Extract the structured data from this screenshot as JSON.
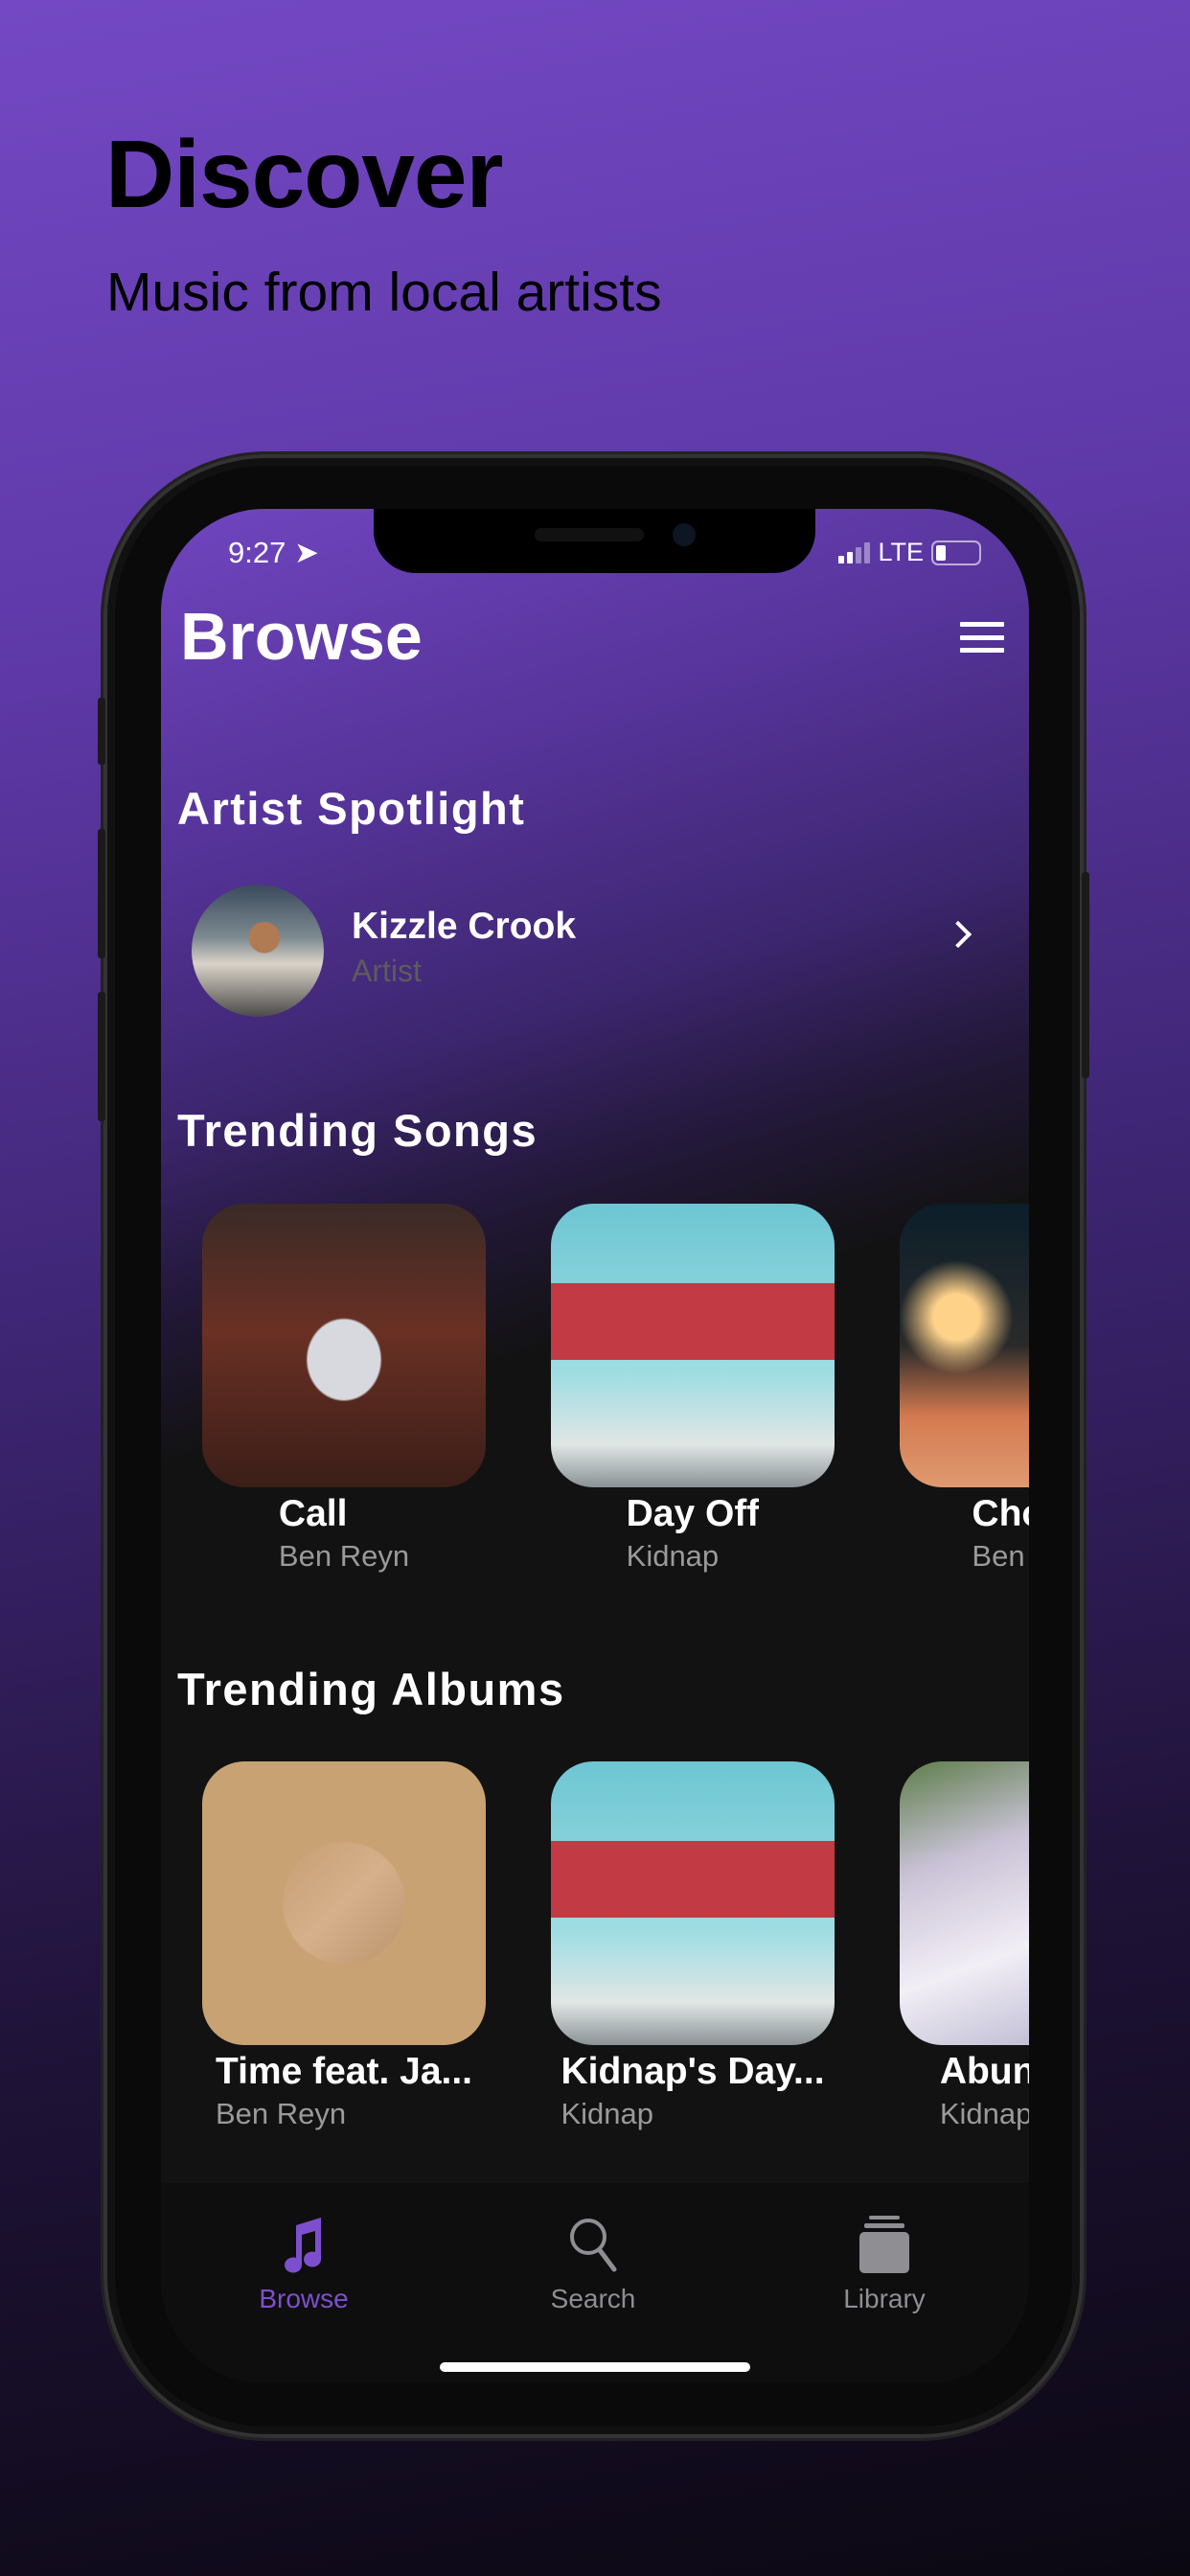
{
  "promo": {
    "title": "Discover",
    "subtitle": "Music from local artists"
  },
  "status": {
    "time": "9:27",
    "network": "LTE"
  },
  "header": {
    "title": "Browse"
  },
  "spotlight": {
    "section_title": "Artist Spotlight",
    "artist_name": "Kizzle Crook",
    "artist_role": "Artist"
  },
  "trending_songs": {
    "section_title": "Trending Songs",
    "items": [
      {
        "title": "Call",
        "artist": "Ben Reyn"
      },
      {
        "title": "Day Off",
        "artist": "Kidnap"
      },
      {
        "title": "Choppa",
        "artist": "Ben Reyn"
      }
    ]
  },
  "trending_albums": {
    "section_title": "Trending Albums",
    "items": [
      {
        "title": "Time feat. Ja...",
        "artist": "Ben Reyn"
      },
      {
        "title": "Kidnap's Day...",
        "artist": "Kidnap"
      },
      {
        "title": "Abundance",
        "artist": "Kidnap"
      }
    ]
  },
  "tabbar": {
    "active_color": "#7d4fcf",
    "inactive_color": "#8e8e93",
    "tabs": [
      {
        "label": "Browse",
        "icon": "music-note-icon",
        "active": true
      },
      {
        "label": "Search",
        "icon": "search-icon",
        "active": false
      },
      {
        "label": "Library",
        "icon": "library-icon",
        "active": false
      }
    ]
  }
}
